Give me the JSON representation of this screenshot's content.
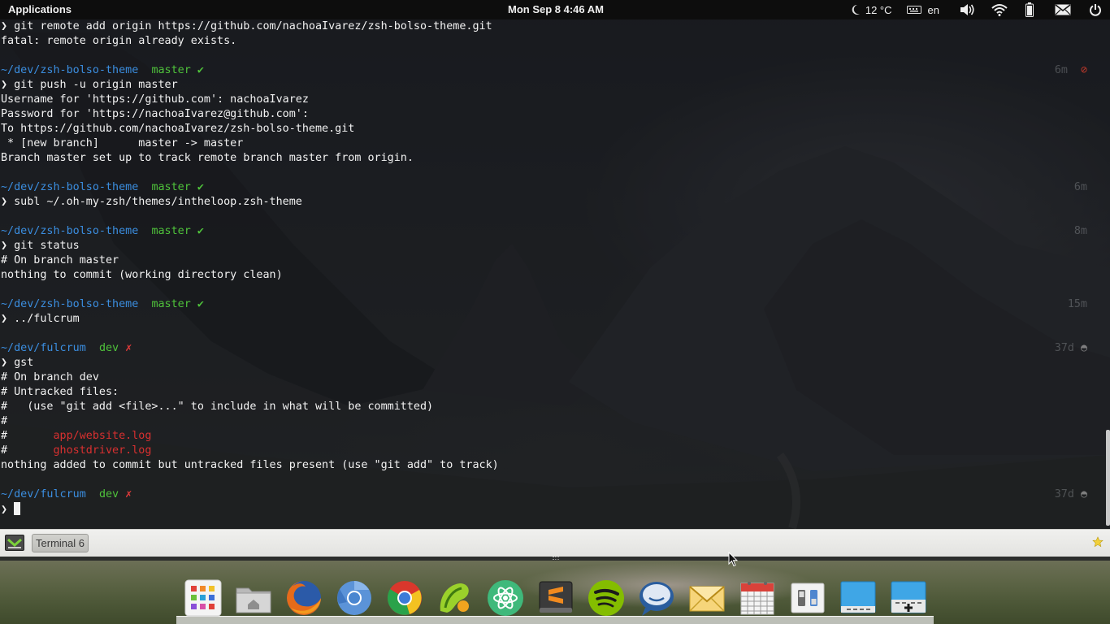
{
  "top_panel": {
    "applications_label": "Applications",
    "clock": "Mon Sep  8  4:46 AM",
    "weather_temp": "12 °C",
    "keyboard_layout": "en",
    "icons": [
      "weather-night-icon",
      "keyboard-icon",
      "volume-icon",
      "wifi-icon",
      "battery-icon",
      "mail-icon",
      "power-icon"
    ]
  },
  "terminal": {
    "lines": [
      {
        "segments": [
          {
            "t": "❯ git remote add origin https://github.com/nachoaIvarez/zsh-bolso-theme.git",
            "c": ""
          }
        ]
      },
      {
        "segments": [
          {
            "t": "fatal: remote origin already exists.",
            "c": ""
          }
        ]
      },
      {
        "segments": [
          {
            "t": "",
            "c": ""
          }
        ]
      },
      {
        "segments": [
          {
            "t": "~/dev/zsh-bolso-theme",
            "c": "cwd"
          },
          {
            "t": "  ",
            "c": ""
          },
          {
            "t": "master",
            "c": "branch"
          },
          {
            "t": " ",
            "c": ""
          },
          {
            "t": "✔",
            "c": "clean"
          }
        ],
        "rprompt": "6m",
        "rmark": "⊘",
        "rmark_class": "mark-red"
      },
      {
        "segments": [
          {
            "t": "❯ git push -u origin master",
            "c": ""
          }
        ]
      },
      {
        "segments": [
          {
            "t": "Username for 'https://github.com': nachoaIvarez",
            "c": ""
          }
        ]
      },
      {
        "segments": [
          {
            "t": "Password for 'https://nachoaIvarez@github.com':",
            "c": ""
          }
        ]
      },
      {
        "segments": [
          {
            "t": "To https://github.com/nachoaIvarez/zsh-bolso-theme.git",
            "c": ""
          }
        ]
      },
      {
        "segments": [
          {
            "t": " * [new branch]      master -> master",
            "c": ""
          }
        ]
      },
      {
        "segments": [
          {
            "t": "Branch master set up to track remote branch master from origin.",
            "c": ""
          }
        ]
      },
      {
        "segments": [
          {
            "t": "",
            "c": ""
          }
        ]
      },
      {
        "segments": [
          {
            "t": "~/dev/zsh-bolso-theme",
            "c": "cwd"
          },
          {
            "t": "  ",
            "c": ""
          },
          {
            "t": "master",
            "c": "branch"
          },
          {
            "t": " ",
            "c": ""
          },
          {
            "t": "✔",
            "c": "clean"
          }
        ],
        "rprompt": "6m"
      },
      {
        "segments": [
          {
            "t": "❯ subl ~/.oh-my-zsh/themes/intheloop.zsh-theme",
            "c": ""
          }
        ]
      },
      {
        "segments": [
          {
            "t": "",
            "c": ""
          }
        ]
      },
      {
        "segments": [
          {
            "t": "~/dev/zsh-bolso-theme",
            "c": "cwd"
          },
          {
            "t": "  ",
            "c": ""
          },
          {
            "t": "master",
            "c": "branch"
          },
          {
            "t": " ",
            "c": ""
          },
          {
            "t": "✔",
            "c": "clean"
          }
        ],
        "rprompt": "8m"
      },
      {
        "segments": [
          {
            "t": "❯ git status",
            "c": ""
          }
        ]
      },
      {
        "segments": [
          {
            "t": "# On branch master",
            "c": ""
          }
        ]
      },
      {
        "segments": [
          {
            "t": "nothing to commit (working directory clean)",
            "c": ""
          }
        ]
      },
      {
        "segments": [
          {
            "t": "",
            "c": ""
          }
        ]
      },
      {
        "segments": [
          {
            "t": "~/dev/zsh-bolso-theme",
            "c": "cwd"
          },
          {
            "t": "  ",
            "c": ""
          },
          {
            "t": "master",
            "c": "branch"
          },
          {
            "t": " ",
            "c": ""
          },
          {
            "t": "✔",
            "c": "clean"
          }
        ],
        "rprompt": "15m"
      },
      {
        "segments": [
          {
            "t": "❯ ../fulcrum",
            "c": ""
          }
        ]
      },
      {
        "segments": [
          {
            "t": "",
            "c": ""
          }
        ]
      },
      {
        "segments": [
          {
            "t": "~/dev/fulcrum",
            "c": "cwd"
          },
          {
            "t": "  ",
            "c": ""
          },
          {
            "t": "dev",
            "c": "branch"
          },
          {
            "t": " ",
            "c": ""
          },
          {
            "t": "✗",
            "c": "dirty"
          }
        ],
        "rprompt": "37d",
        "rmark": "◓",
        "rmark_class": "mark-dim"
      },
      {
        "segments": [
          {
            "t": "❯ gst",
            "c": ""
          }
        ]
      },
      {
        "segments": [
          {
            "t": "# On branch dev",
            "c": ""
          }
        ]
      },
      {
        "segments": [
          {
            "t": "# Untracked files:",
            "c": ""
          }
        ]
      },
      {
        "segments": [
          {
            "t": "#   (use \"git add <file>...\" to include in what will be committed)",
            "c": ""
          }
        ]
      },
      {
        "segments": [
          {
            "t": "#",
            "c": ""
          }
        ]
      },
      {
        "segments": [
          {
            "t": "#       ",
            "c": ""
          },
          {
            "t": "app/website.log",
            "c": "untracked"
          }
        ]
      },
      {
        "segments": [
          {
            "t": "#       ",
            "c": ""
          },
          {
            "t": "ghostdriver.log",
            "c": "untracked"
          }
        ]
      },
      {
        "segments": [
          {
            "t": "nothing added to commit but untracked files present (use \"git add\" to track)",
            "c": ""
          }
        ]
      },
      {
        "segments": [
          {
            "t": "",
            "c": ""
          }
        ]
      },
      {
        "segments": [
          {
            "t": "~/dev/fulcrum",
            "c": "cwd"
          },
          {
            "t": "  ",
            "c": ""
          },
          {
            "t": "dev",
            "c": "branch"
          },
          {
            "t": " ",
            "c": ""
          },
          {
            "t": "✗",
            "c": "dirty"
          }
        ],
        "rprompt": "37d",
        "rmark": "◓",
        "rmark_class": "mark-dim"
      },
      {
        "segments": [
          {
            "t": "❯ ",
            "c": ""
          }
        ],
        "cursor": true
      }
    ]
  },
  "taskbar": {
    "window_button_label": "Terminal 6"
  },
  "dock": {
    "items": [
      {
        "name": "app-grid-launcher-icon"
      },
      {
        "name": "files-home-icon"
      },
      {
        "name": "firefox-icon"
      },
      {
        "name": "chromium-icon"
      },
      {
        "name": "chrome-icon"
      },
      {
        "name": "phpstorm-icon"
      },
      {
        "name": "atom-icon"
      },
      {
        "name": "sublime-text-icon"
      },
      {
        "name": "spotify-icon"
      },
      {
        "name": "chat-icon"
      },
      {
        "name": "mail-icon"
      },
      {
        "name": "calendar-icon"
      },
      {
        "name": "settings-toggle-icon"
      },
      {
        "name": "workspace-icon"
      },
      {
        "name": "add-workspace-icon"
      }
    ]
  },
  "colors": {
    "prompt_cwd": "#3b8ee0",
    "prompt_branch": "#4fc23b",
    "dirty_mark": "#e83b3b",
    "untracked_file": "#d83030"
  }
}
